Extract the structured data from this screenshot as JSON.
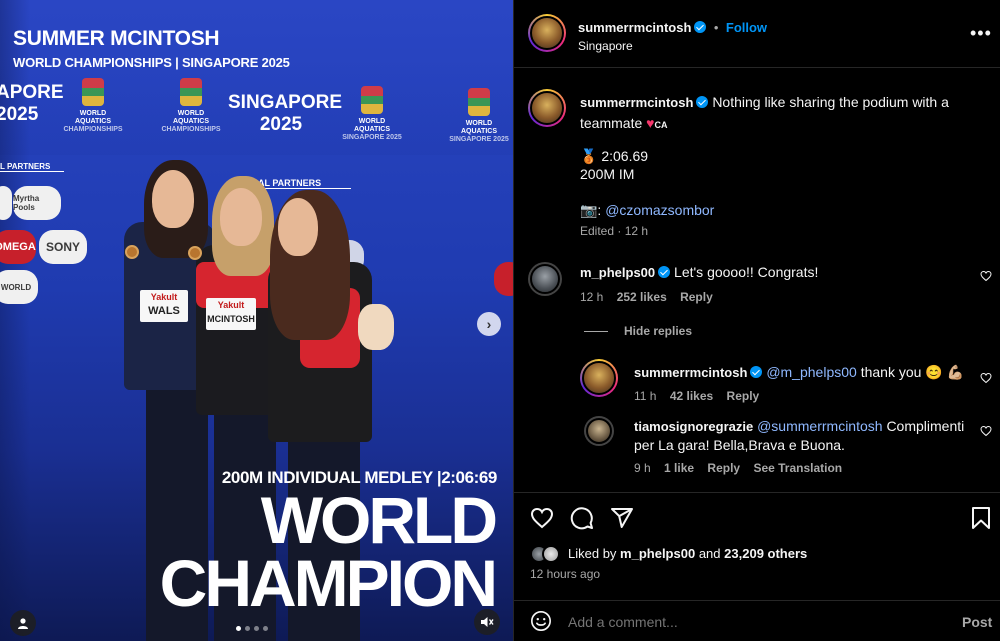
{
  "media": {
    "overlay_athlete": "SUMMER MCINTOSH",
    "overlay_event": "WORLD CHAMPIONSHIPS | SINGAPORE 2025",
    "backdrop_city_left": "APORE",
    "backdrop_year_left": "2025",
    "backdrop_city": "SINGAPORE",
    "backdrop_year": "2025",
    "backdrop_org": "WORLD AQUATICS",
    "backdrop_org_sub": "CHAMPIONSHIPS",
    "backdrop_org_city": "SINGAPORE 2025",
    "partners_label": "L PARTNERS",
    "partners_label_2": "AL PARTNERS",
    "sponsors": [
      "OMEGA",
      "SONY",
      "Myrtha Pools",
      "WORLD"
    ],
    "bib_left": "WALS",
    "bib_center_brand": "Yakult",
    "bib_center": "MCINTOSH",
    "bib_left_brand": "Yakult",
    "caption_event": "200M INDIVIDUAL MEDLEY |2:06:69",
    "caption_line1": "WORLD",
    "caption_line2": "CHAMPION",
    "slide_count": 4,
    "active_slide": 0
  },
  "header": {
    "username": "summerrmcintosh",
    "follow_label": "Follow",
    "separator": "•",
    "location": "Singapore",
    "more_label": "•••"
  },
  "caption": {
    "username": "summerrmcintosh",
    "text": "Nothing like sharing the podium with a teammate",
    "flag_suffix": "CA",
    "medal_line": "🥉 2:06.69",
    "event_line": "200M IM",
    "credit_prefix": "📷:",
    "credit_handle": "@czomazsombor",
    "edited": "Edited · 12 h"
  },
  "comments": [
    {
      "username": "m_phelps00",
      "text": "Let's goooo!! Congrats!",
      "time": "12 h",
      "likes": "252 likes",
      "reply_label": "Reply",
      "hide_replies": "Hide replies",
      "replies": [
        {
          "username": "summerrmcintosh",
          "mention": "@m_phelps00",
          "text": "thank you 😊 💪🏼",
          "time": "11 h",
          "likes": "42 likes",
          "reply_label": "Reply"
        },
        {
          "username": "tiamosignoregrazie",
          "mention": "@summerrmcintosh",
          "text_a": "Complimenti",
          "text_b": "per La gara! Bella,Brava e Buona.",
          "time": "9 h",
          "likes": "1 like",
          "reply_label": "Reply",
          "translate_label": "See Translation"
        }
      ]
    }
  ],
  "footer": {
    "liked_by_prefix": "Liked by",
    "liked_by_user": "m_phelps00",
    "liked_by_and": "and",
    "liked_by_count": "23,209 others",
    "post_time": "12 hours ago",
    "comment_placeholder": "Add a comment...",
    "post_label": "Post"
  },
  "icons": {
    "like": "heart-icon",
    "comment": "comment-icon",
    "share": "send-icon",
    "save": "bookmark-icon",
    "emoji": "smiley-icon",
    "next": "chevron-right-icon",
    "tag": "user-tag-icon",
    "mute": "speaker-muted-icon"
  },
  "colors": {
    "accent": "#0095f6",
    "background": "#000000",
    "text": "#f5f5f5",
    "muted": "#a8a8a8"
  }
}
